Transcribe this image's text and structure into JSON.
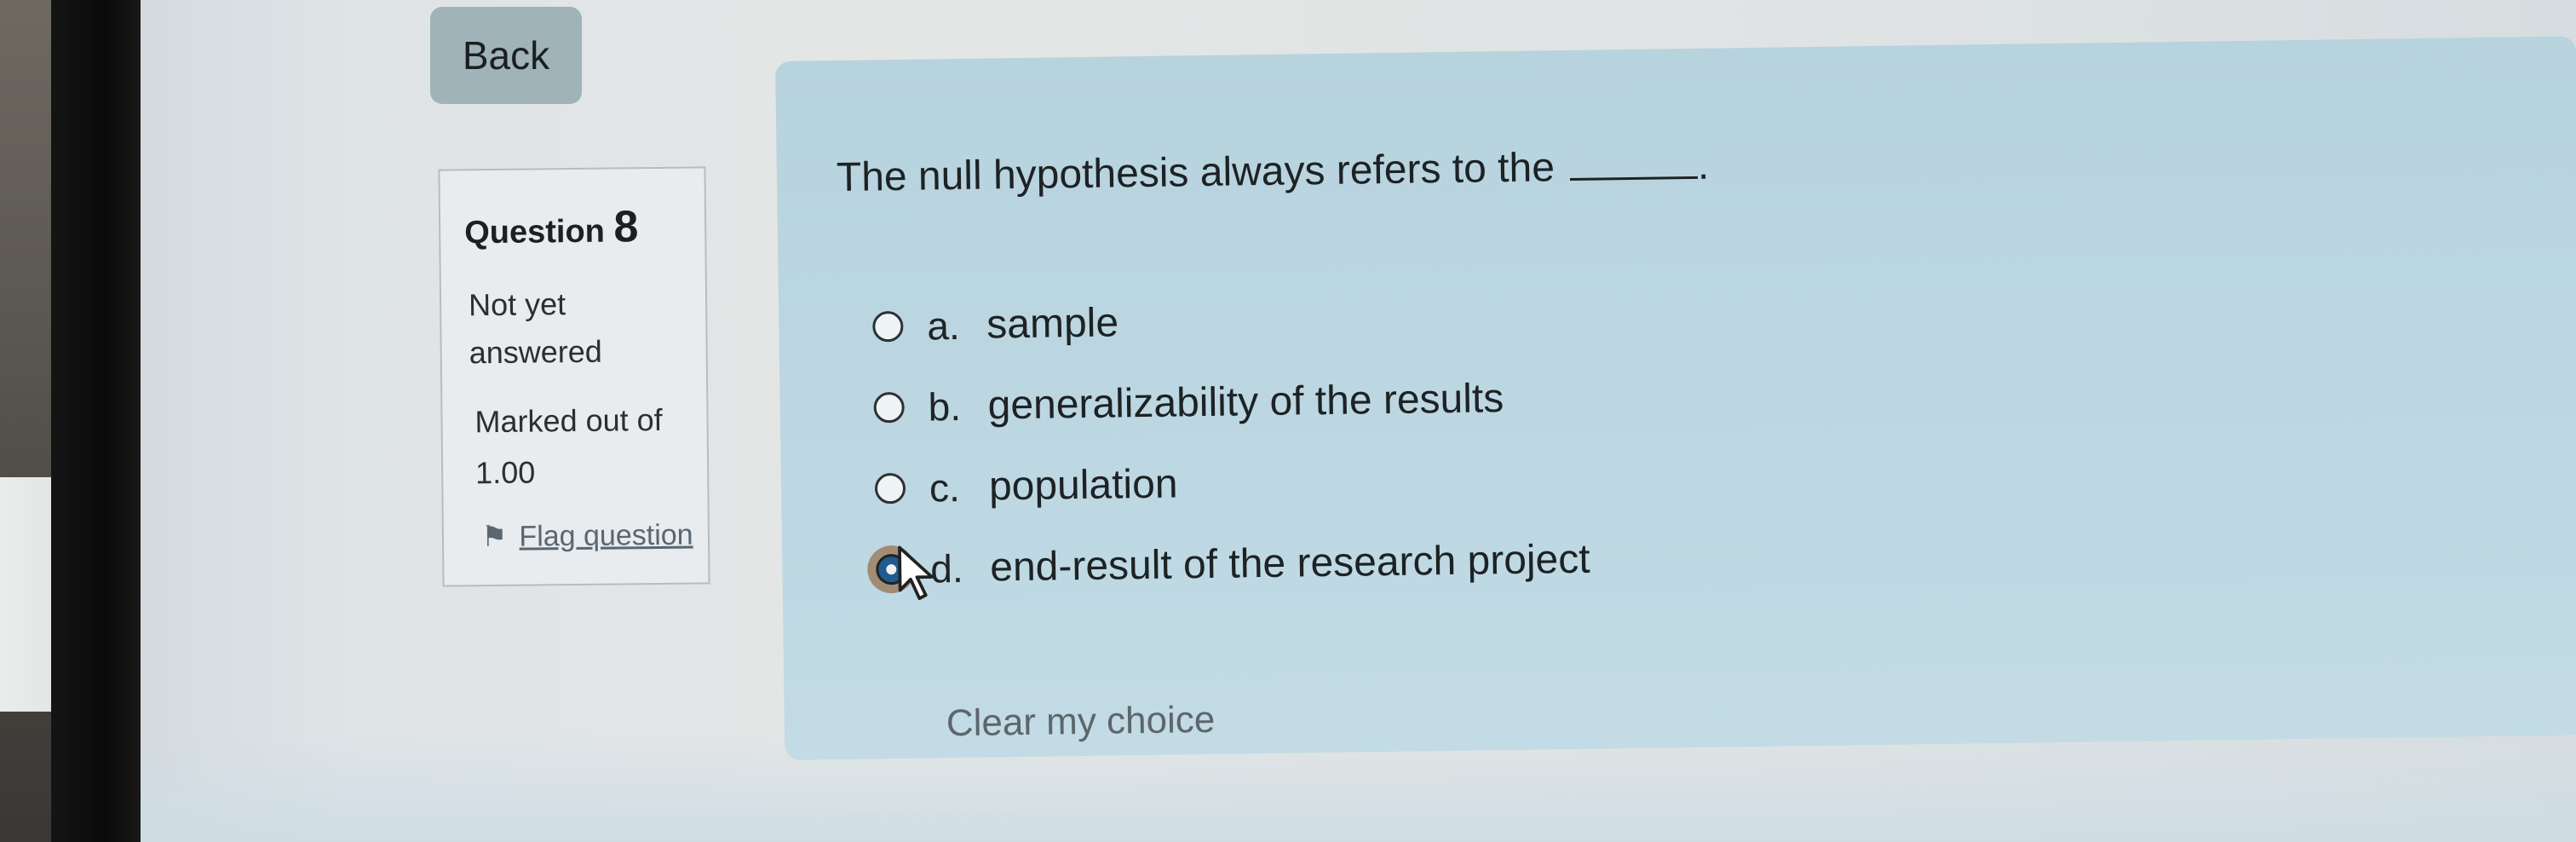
{
  "nav": {
    "back_label": "Back"
  },
  "question_info": {
    "question_word": "Question",
    "question_number": "8",
    "status": "Not yet answered",
    "marked_label": "Marked out of",
    "marked_value": "1.00",
    "flag_label": "Flag question",
    "flag_icon": "flag-icon"
  },
  "question": {
    "text": "The null hypothesis always refers to the",
    "trailing": ".",
    "options": [
      {
        "letter": "a.",
        "text": "sample",
        "selected": false
      },
      {
        "letter": "b.",
        "text": "generalizability of the results",
        "selected": false
      },
      {
        "letter": "c.",
        "text": "population",
        "selected": false
      },
      {
        "letter": "d.",
        "text": "end-result of the research project",
        "selected": true
      }
    ],
    "clear_label": "Clear my choice"
  },
  "colors": {
    "question_panel_bg": "#bcd7e2",
    "info_panel_bg": "#e8ecee",
    "back_button_bg": "#9fb3b8",
    "selected_radio": "#1f5b8f"
  }
}
